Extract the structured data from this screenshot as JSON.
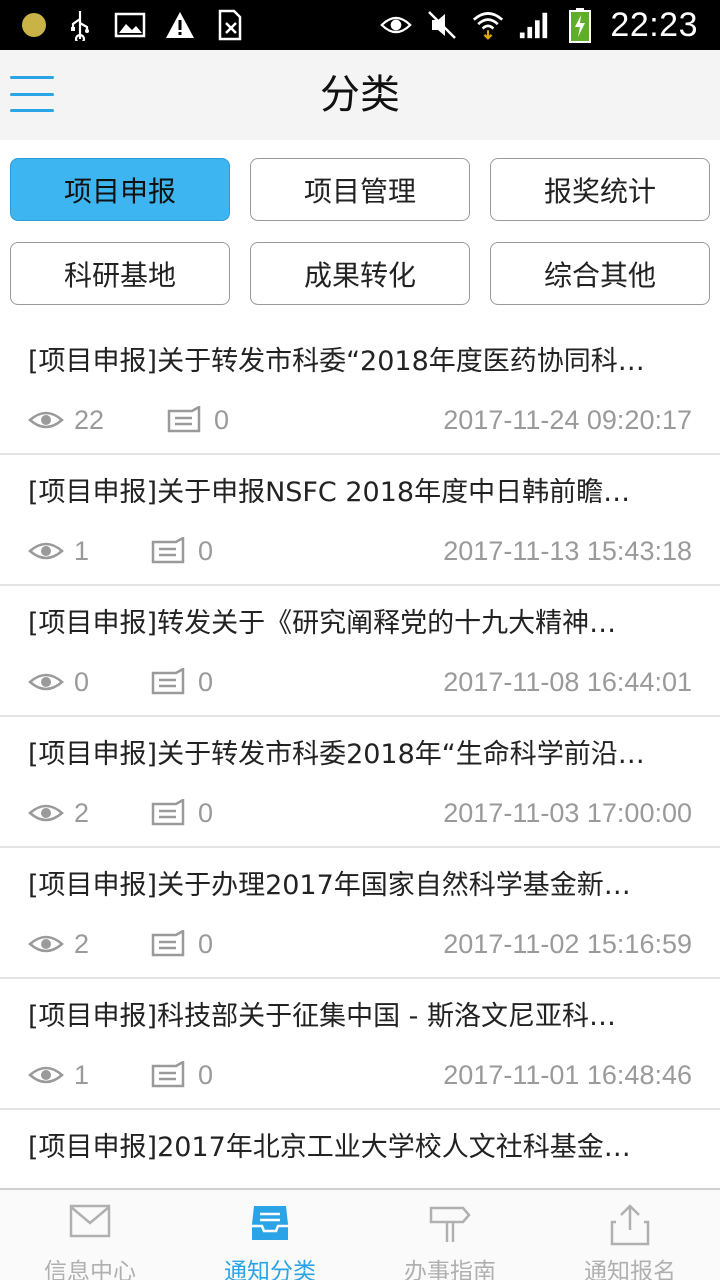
{
  "status_bar": {
    "time": "22:23",
    "icons": [
      "notification-dot-icon",
      "usb-icon",
      "image-icon",
      "warning-icon",
      "sim-icon",
      "eye-icon",
      "mute-icon",
      "wifi-icon",
      "signal-icon",
      "battery-icon"
    ]
  },
  "header": {
    "title": "分类",
    "menu_icon": "hamburger-menu-icon"
  },
  "categories": [
    {
      "label": "项目申报",
      "active": true
    },
    {
      "label": "项目管理",
      "active": false
    },
    {
      "label": "报奖统计",
      "active": false
    },
    {
      "label": "科研基地",
      "active": false
    },
    {
      "label": "成果转化",
      "active": false
    },
    {
      "label": "综合其他",
      "active": false
    }
  ],
  "items": [
    {
      "title": "[项目申报]关于转发市科委“2018年度医药协同科…",
      "views": "22",
      "comments": "0",
      "date": "2017-11-24 09:20:17"
    },
    {
      "title": "[项目申报]关于申报NSFC 2018年度中日韩前瞻…",
      "views": "1",
      "comments": "0",
      "date": "2017-11-13 15:43:18"
    },
    {
      "title": "[项目申报]转发关于《研究阐释党的十九大精神…",
      "views": "0",
      "comments": "0",
      "date": "2017-11-08 16:44:01"
    },
    {
      "title": "[项目申报]关于转发市科委2018年“生命科学前沿…",
      "views": "2",
      "comments": "0",
      "date": "2017-11-03 17:00:00"
    },
    {
      "title": "[项目申报]关于办理2017年国家自然科学基金新…",
      "views": "2",
      "comments": "0",
      "date": "2017-11-02 15:16:59"
    },
    {
      "title": "[项目申报]科技部关于征集中国 - 斯洛文尼亚科…",
      "views": "1",
      "comments": "0",
      "date": "2017-11-01 16:48:46"
    },
    {
      "title": "[项目申报]2017年北京工业大学校人文社科基金…",
      "views": "",
      "comments": "",
      "date": ""
    }
  ],
  "bottom_nav": [
    {
      "label": "信息中心",
      "icon": "mail-icon",
      "active": false
    },
    {
      "label": "通知分类",
      "icon": "inbox-tray-icon",
      "active": true
    },
    {
      "label": "办事指南",
      "icon": "signpost-icon",
      "active": false
    },
    {
      "label": "通知报名",
      "icon": "share-upload-icon",
      "active": false
    }
  ],
  "colors": {
    "accent": "#2aa4e6",
    "chip_active": "#3db5f0",
    "meta_text": "#9a9a9a",
    "status_bar_bg": "#000000"
  }
}
